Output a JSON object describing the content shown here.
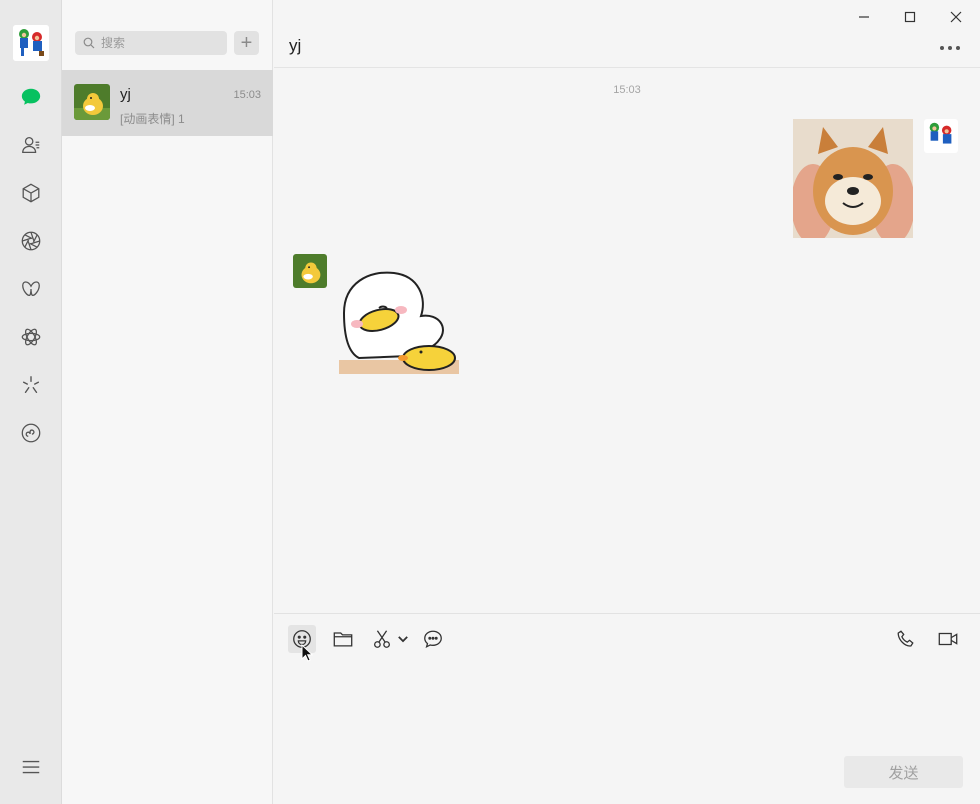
{
  "search": {
    "placeholder": "搜索"
  },
  "conversation": {
    "name": "yj",
    "time": "15:03",
    "preview": "[动画表情] 1"
  },
  "chat": {
    "title": "yj",
    "timestamp": "15:03"
  },
  "composer": {
    "send_label": "发送"
  },
  "colors": {
    "accent": "#07c160",
    "selected": "#d9d9d9"
  },
  "icons": {
    "nav": [
      "chat-icon",
      "contacts-icon",
      "favorites-icon",
      "moments-icon",
      "channels-icon",
      "search-network-icon",
      "top-stories-icon",
      "mini-programs-icon"
    ],
    "toolbar": [
      "emoji-icon",
      "folder-icon",
      "scissors-icon",
      "chat-history-icon",
      "phone-icon",
      "video-icon"
    ]
  }
}
